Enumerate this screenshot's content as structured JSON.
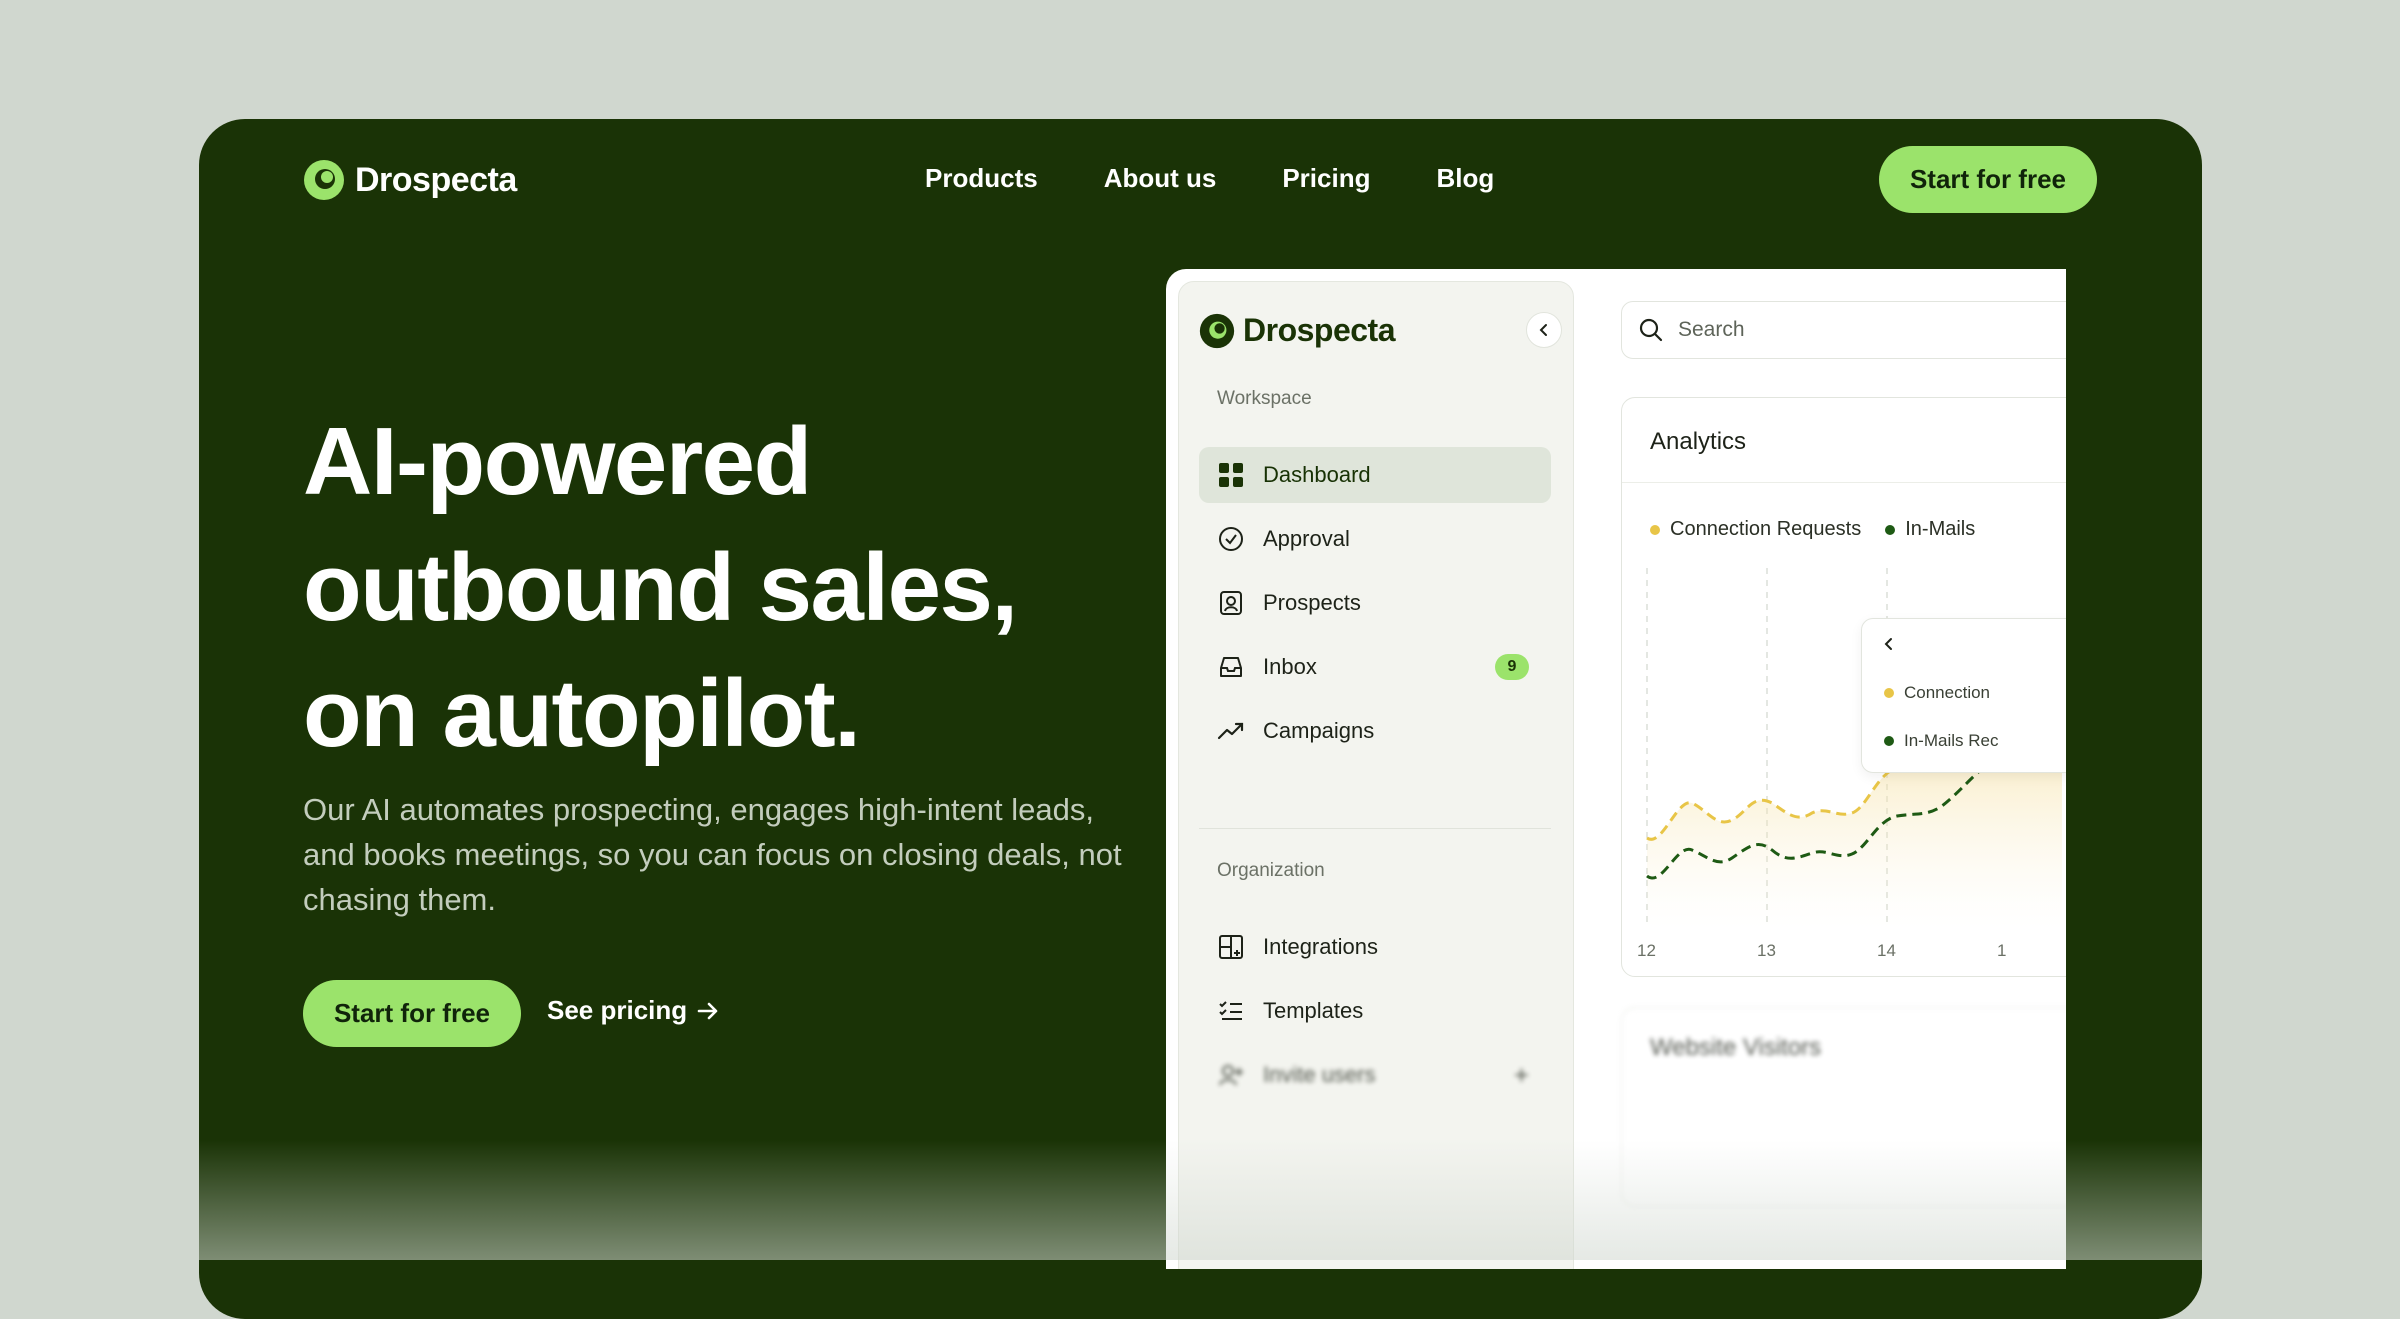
{
  "brand": {
    "name": "Drospecta"
  },
  "nav": {
    "items": [
      "Products",
      "About us",
      "Pricing",
      "Blog"
    ]
  },
  "header": {
    "cta_label": "Start for free"
  },
  "hero": {
    "headline_lines": [
      "AI-powered",
      "outbound sales,",
      "on autopilot."
    ],
    "subtext": "Our AI automates prospecting, engages high-intent leads, and books meetings, so you can focus on closing deals, not chasing them.",
    "primary_cta": "Start for free",
    "secondary_cta": "See pricing"
  },
  "app": {
    "brand": "Drospecta",
    "search": {
      "placeholder": "Search"
    },
    "sidebar": {
      "workspace_label": "Workspace",
      "workspace_items": [
        {
          "label": "Dashboard",
          "icon": "dashboard-icon",
          "active": true
        },
        {
          "label": "Approval",
          "icon": "check-circle-icon"
        },
        {
          "label": "Prospects",
          "icon": "contact-card-icon"
        },
        {
          "label": "Inbox",
          "icon": "inbox-icon",
          "badge": "9"
        },
        {
          "label": "Campaigns",
          "icon": "trend-icon"
        }
      ],
      "organization_label": "Organization",
      "organization_items": [
        {
          "label": "Integrations",
          "icon": "integrations-icon"
        },
        {
          "label": "Templates",
          "icon": "templates-icon"
        },
        {
          "label": "Invite users",
          "icon": "user-plus-icon"
        }
      ]
    },
    "analytics": {
      "title": "Analytics",
      "legend": [
        "Connection Requests",
        "In-Mails"
      ],
      "tooltip_rows": [
        "Connection",
        "In-Mails Rec"
      ],
      "x_ticks": [
        "12",
        "13",
        "14",
        "1"
      ]
    },
    "second_card_title": "Website Visitors"
  },
  "colors": {
    "brand_dark": "#1a3306",
    "accent_green": "#9be36b",
    "series_connection": "#e8c547",
    "series_inmails": "#1e5a14",
    "page_bg": "#d0d7cf"
  }
}
